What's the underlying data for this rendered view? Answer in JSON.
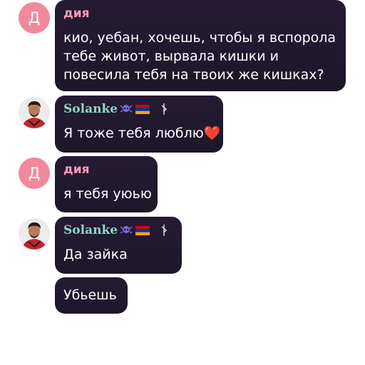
{
  "messages": [
    {
      "author": "дия",
      "avatar_letter": "Д",
      "avatar_color": "#f0899c",
      "name_color": "#f29ab8",
      "text": "кио, уебан, хочешь, чтобы я вспорола\nтебе живот, вырвала кишки и\nповесила тебя на твоих же кишках?"
    },
    {
      "author": "Solanke",
      "avatar_icon": "user-photo",
      "name_color": "#8fd6c6",
      "badges": [
        "skull-badge-icon",
        "armenia-flag-icon",
        "tool-icon"
      ],
      "text": "Я тоже тебя люблю❤️"
    },
    {
      "author": "дия",
      "avatar_letter": "Д",
      "text": "я тебя уюью"
    },
    {
      "author": "Solanke",
      "avatar_icon": "user-photo",
      "badges": [
        "skull-badge-icon",
        "armenia-flag-icon",
        "tool-icon"
      ],
      "text": "Да зайка"
    },
    {
      "text": "Убьешь"
    }
  ],
  "colors": {
    "bubble": "#221a30",
    "background": "#ffffff",
    "flag_red": "#d90012",
    "flag_blue": "#0033a0",
    "flag_orange": "#f2a800"
  }
}
